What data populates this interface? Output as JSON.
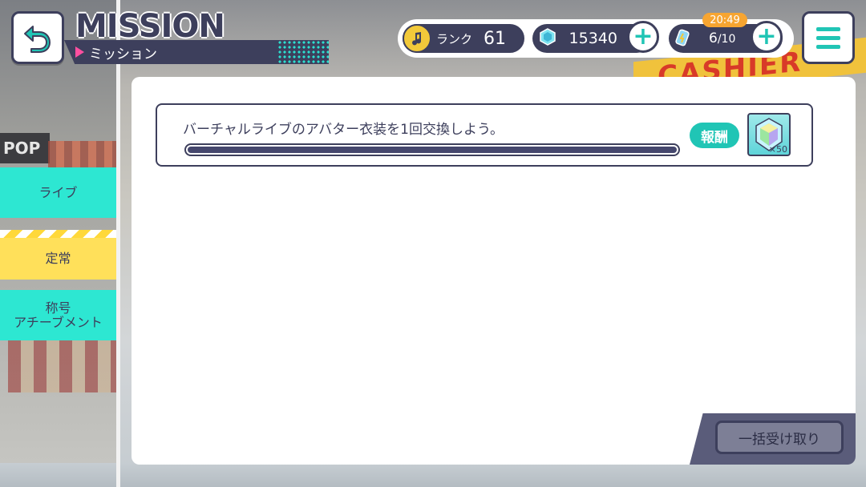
{
  "header": {
    "title": "MISSION",
    "subtitle": "ミッション"
  },
  "status": {
    "rank_label": "ランク",
    "rank_value": "61",
    "gems": "15340",
    "stamina_current": "6",
    "stamina_max": "/10",
    "stamina_timer": "20:49"
  },
  "sidebar": {
    "items": [
      {
        "label": "ライブ"
      },
      {
        "label": "定常"
      },
      {
        "label": "称号\nアチーブメント",
        "line1": "称号",
        "line2": "アチーブメント"
      }
    ]
  },
  "missions": [
    {
      "text": "バーチャルライブのアバター衣装を1回交換しよう。",
      "progress": 1.0,
      "reward_label": "報酬",
      "reward_icon": "crystal-icon",
      "reward_qty": "×50"
    }
  ],
  "footer": {
    "bulk_receive_label": "一括受け取り"
  },
  "colors": {
    "navy": "#3d3f5c",
    "teal": "#2de7d2",
    "yellow": "#ffe05a",
    "pink": "#ff4fa0"
  }
}
